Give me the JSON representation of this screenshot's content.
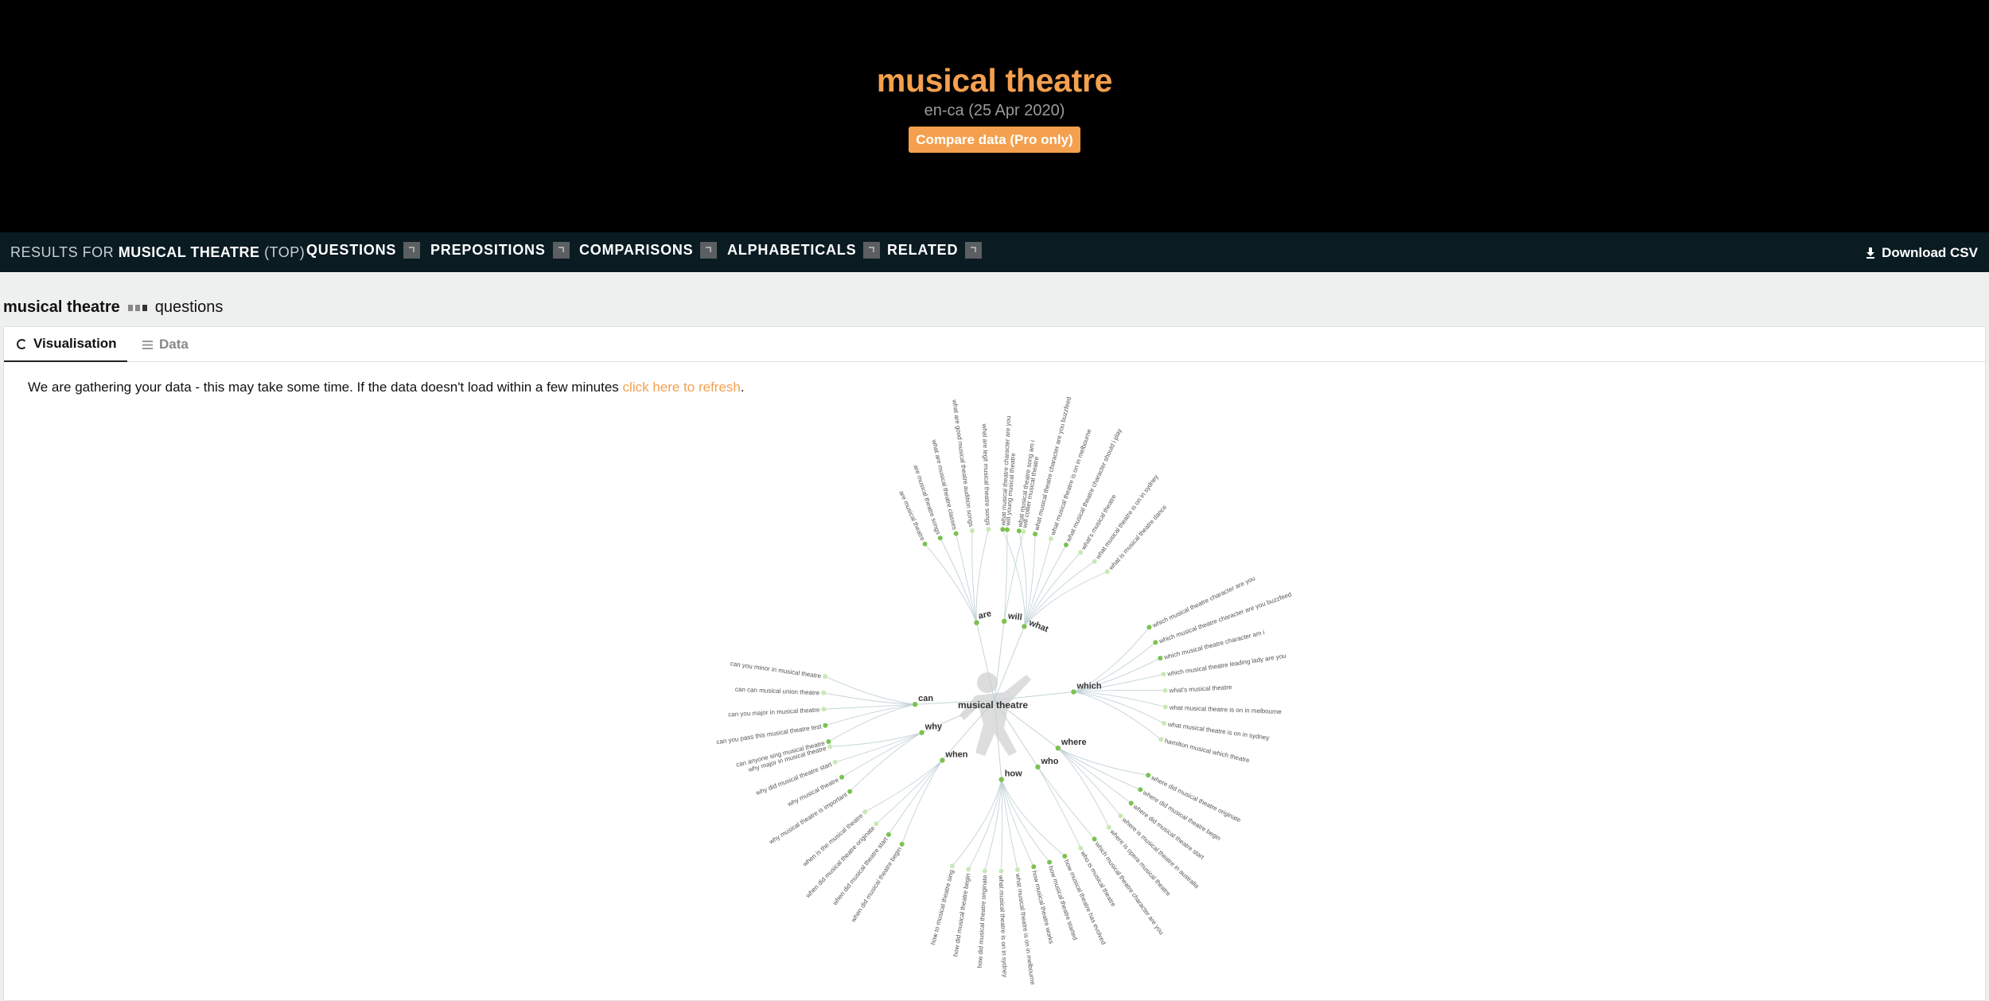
{
  "hero": {
    "title": "musical theatre",
    "subtitle": "en-ca (25 Apr 2020)",
    "compare_label": "Compare data (Pro only)"
  },
  "nav": {
    "results_prefix": "RESULTS FOR",
    "results_term": "MUSICAL THEATRE",
    "results_suffix": "(TOP)",
    "tabs": [
      "QUESTIONS",
      "PREPOSITIONS",
      "COMPARISONS",
      "ALPHABETICALS",
      "RELATED"
    ],
    "download_label": "Download CSV"
  },
  "section": {
    "term": "musical theatre",
    "kind": "questions"
  },
  "panel": {
    "tab_visualisation": "Visualisation",
    "tab_data": "Data",
    "notice_text": "We are gathering your data - this may take some time. If the data doesn't load within a few minutes",
    "notice_link": "click here to refresh",
    "notice_end": "."
  },
  "wheel": {
    "center": "musical theatre",
    "colors": {
      "strong": "#7bc24f",
      "light": "#c9e8b6",
      "link": "#c3d3d8",
      "label": "#555555"
    },
    "branches": [
      {
        "name": "what",
        "leaves": [
          [
            "what musical theatre character are you",
            "strong"
          ],
          [
            "what musical theatre song am i",
            "strong"
          ],
          [
            "what musical theatre character are you buzzfeed",
            "strong"
          ],
          [
            "what musical theatre is on in melbourne",
            "light"
          ],
          [
            "what musical theatre character should i play",
            "strong"
          ],
          [
            "what's musical theatre",
            "light"
          ],
          [
            "what musical theatre is on in sydney",
            "light"
          ],
          [
            "what is musical theatre dance",
            "light"
          ]
        ]
      },
      {
        "name": "will",
        "leaves": [
          [
            "will young musical theatre",
            "strong"
          ],
          [
            "will collier musical theatre",
            "light"
          ]
        ]
      },
      {
        "name": "are",
        "leaves": [
          [
            "are musical theatre",
            "strong"
          ],
          [
            "are musical theatre songs",
            "strong"
          ],
          [
            "what are musical theatre classes",
            "strong"
          ],
          [
            "what are good musical theatre audition songs",
            "light"
          ],
          [
            "what are legit musical theatre songs",
            "light"
          ]
        ]
      },
      {
        "name": "which",
        "leaves": [
          [
            "which musical theatre character are you",
            "strong"
          ],
          [
            "which musical theatre character are you buzzfeed",
            "strong"
          ],
          [
            "which musical theatre character am i",
            "strong"
          ],
          [
            "which musical theatre leading lady are you",
            "light"
          ],
          [
            "what's musical theatre",
            "light"
          ],
          [
            "what musical theatre is on in melbourne",
            "light"
          ],
          [
            "what musical theatre is on in sydney",
            "light"
          ],
          [
            "hamilton musical which theatre",
            "light"
          ]
        ]
      },
      {
        "name": "where",
        "leaves": [
          [
            "where did musical theatre originate",
            "strong"
          ],
          [
            "where did musical theatre begin",
            "strong"
          ],
          [
            "where did musical theatre start",
            "strong"
          ],
          [
            "where is musical theatre in australia",
            "light"
          ],
          [
            "where is opera musical theatre",
            "light"
          ]
        ]
      },
      {
        "name": "who",
        "leaves": [
          [
            "which musical theatre character are you",
            "strong"
          ],
          [
            "who is musical theatre",
            "light"
          ]
        ]
      },
      {
        "name": "how",
        "leaves": [
          [
            "how musical theatre has evolved",
            "strong"
          ],
          [
            "how musical theatre started",
            "strong"
          ],
          [
            "how musical theatre works",
            "strong"
          ],
          [
            "what musical theatre is on in melbourne",
            "light"
          ],
          [
            "what musical theatre is on in sydney",
            "light"
          ],
          [
            "how did musical theatre originate",
            "light"
          ],
          [
            "how did musical theatre begin",
            "light"
          ],
          [
            "how to musical theatre sing",
            "light"
          ]
        ]
      },
      {
        "name": "when",
        "leaves": [
          [
            "when did musical theatre begin",
            "strong"
          ],
          [
            "when did musical theatre start",
            "strong"
          ],
          [
            "when did musical theatre originate",
            "light"
          ],
          [
            "when is the musical theatre",
            "light"
          ]
        ]
      },
      {
        "name": "can",
        "leaves": [
          [
            "can anyone sing musical theatre",
            "strong"
          ],
          [
            "can you pass this musical theatre test",
            "strong"
          ],
          [
            "can you major in musical theatre",
            "light"
          ],
          [
            "can can musical union theatre",
            "light"
          ],
          [
            "can you minor in musical theatre",
            "light"
          ]
        ]
      },
      {
        "name": "why",
        "leaves": [
          [
            "why musical theatre is important",
            "strong"
          ],
          [
            "why musical theatre",
            "strong"
          ],
          [
            "why did musical theatre start",
            "light"
          ],
          [
            "why major in musical theatre",
            "light"
          ]
        ]
      }
    ]
  }
}
